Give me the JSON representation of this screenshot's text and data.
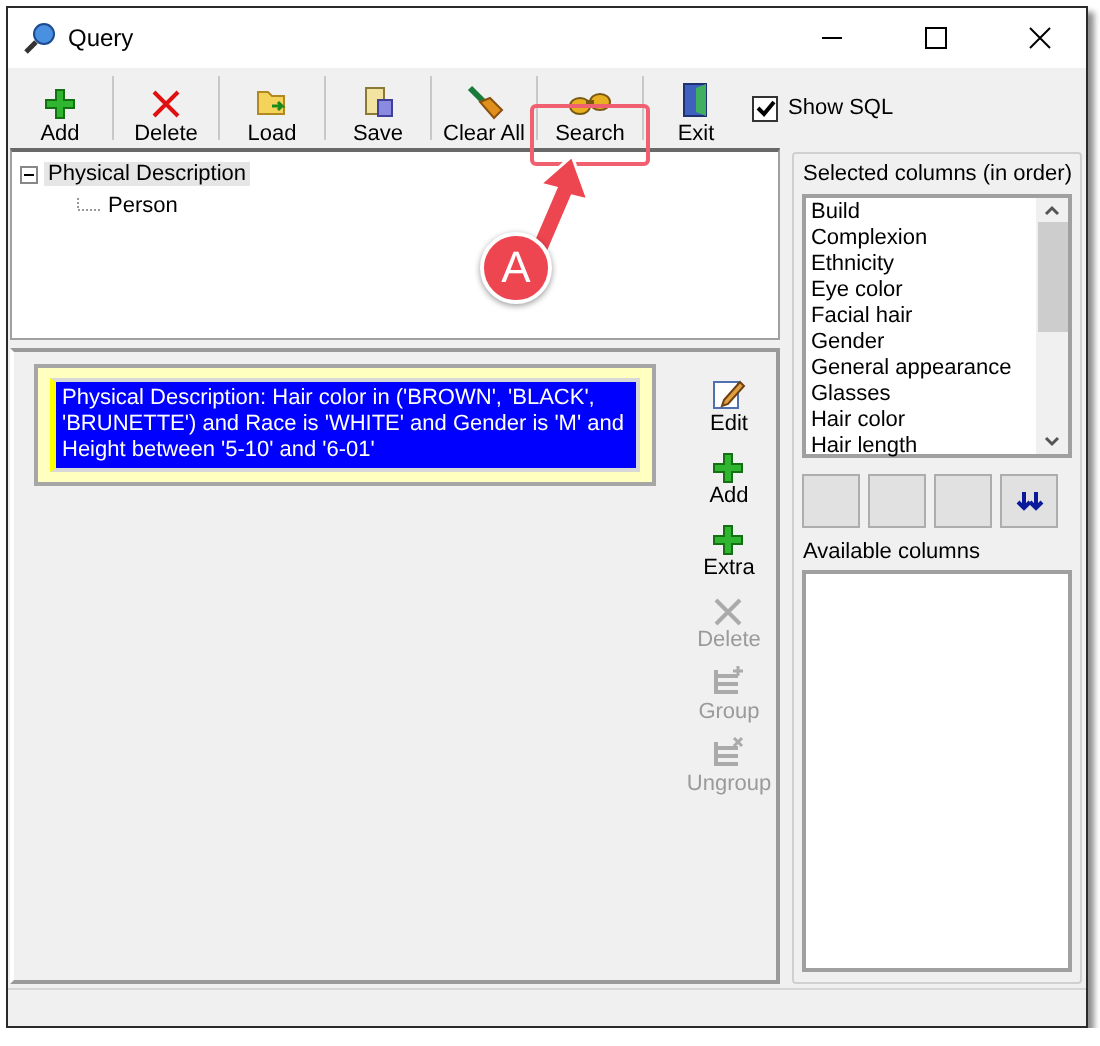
{
  "window": {
    "title": "Query"
  },
  "toolbar": {
    "buttons": [
      {
        "label": "Add",
        "kind": "add"
      },
      {
        "label": "Delete",
        "kind": "delete"
      },
      {
        "label": "Load",
        "kind": "load"
      },
      {
        "label": "Save",
        "kind": "save"
      },
      {
        "label": "Clear All",
        "kind": "clear"
      },
      {
        "label": "Search",
        "kind": "search"
      },
      {
        "label": "Exit",
        "kind": "exit"
      }
    ],
    "show_sql": {
      "label": "Show SQL",
      "checked": true
    }
  },
  "tree": [
    {
      "label": "Physical Description",
      "expanded": true,
      "selected": true,
      "children": [
        {
          "label": "Person",
          "selected": false
        }
      ]
    }
  ],
  "condition": {
    "text": "Physical Description: Hair color in ('BROWN', 'BLACK', 'BRUNETTE') and Race is 'WHITE' and Gender is 'M' and Height between '5-10' and '6-01'",
    "selected": true
  },
  "side_buttons": [
    {
      "label": "Edit",
      "kind": "edit",
      "disabled": false
    },
    {
      "label": "Add",
      "kind": "add",
      "disabled": false
    },
    {
      "label": "Extra",
      "kind": "add",
      "disabled": false
    },
    {
      "label": "Delete",
      "kind": "delete",
      "disabled": true
    },
    {
      "label": "Group",
      "kind": "group",
      "disabled": true
    },
    {
      "label": "Ungroup",
      "kind": "ungroup",
      "disabled": true
    }
  ],
  "selected_columns": {
    "title": "Selected columns (in order)",
    "items": [
      "Build",
      "Complexion",
      "Ethnicity",
      "Eye color",
      "Facial hair",
      "Gender",
      "General appearance",
      "Glasses",
      "Hair color",
      "Hair length"
    ]
  },
  "available_columns": {
    "title": "Available columns"
  },
  "annotation": {
    "label": "A"
  }
}
